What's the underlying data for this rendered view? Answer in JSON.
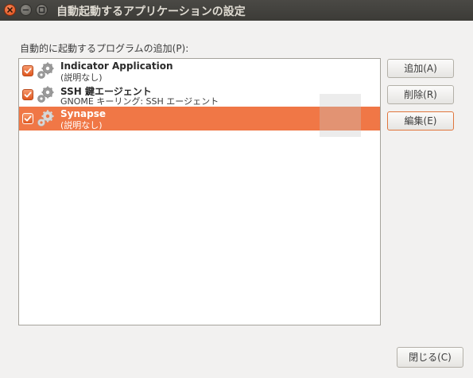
{
  "window": {
    "title": "自動起動するアプリケーションの設定"
  },
  "list_label": "自動的に起動するプログラムの追加(P):",
  "programs": [
    {
      "name": "Indicator Application",
      "description": "(説明なし)",
      "checked": true,
      "icon": "gears-icon",
      "selected": false
    },
    {
      "name": "SSH 鍵エージェント",
      "description": "GNOME キーリング: SSH エージェント",
      "checked": true,
      "icon": "gears-icon",
      "selected": false
    },
    {
      "name": "Synapse",
      "description": "(説明なし)",
      "checked": true,
      "icon": "gears-icon",
      "selected": true
    }
  ],
  "buttons": {
    "add": "追加(A)",
    "remove": "削除(R)",
    "edit": "編集(E)",
    "close": "閉じる(C)"
  },
  "colors": {
    "accent": "#f07746",
    "titlebar": "#3c3b37",
    "close_button": "#df4a16"
  }
}
